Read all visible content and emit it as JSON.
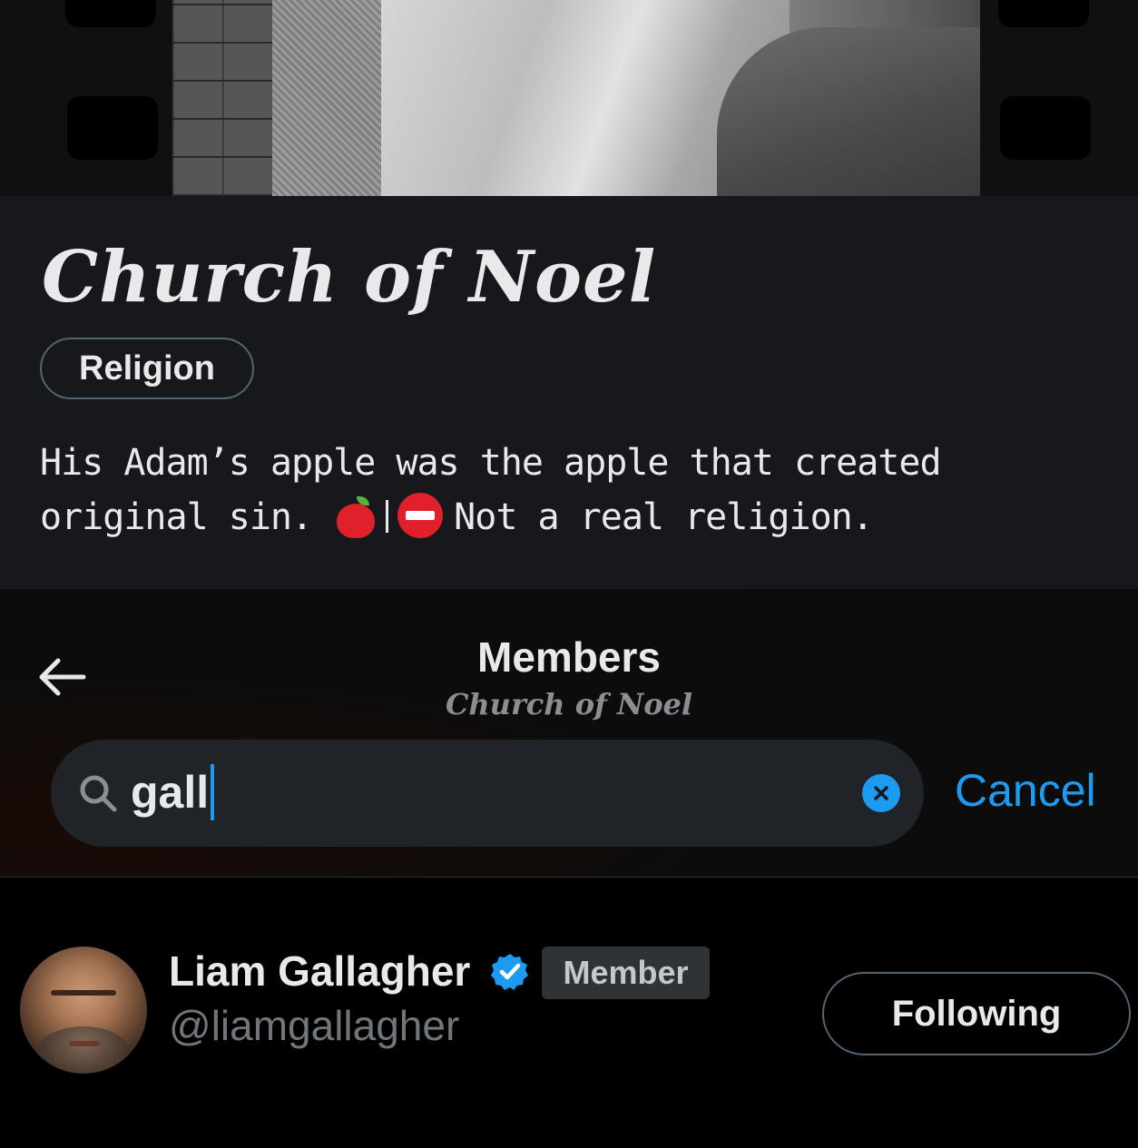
{
  "community": {
    "title": "Church of Noel",
    "category": "Religion",
    "description_part1": "His Adam’s apple was the apple that created original sin.",
    "description_part2": "Not a real religion."
  },
  "header": {
    "title": "Members",
    "subtitle": "Church of Noel"
  },
  "search": {
    "query": "gall",
    "cancel_label": "Cancel"
  },
  "results": [
    {
      "name": "Liam Gallagher",
      "handle": "@liamgallagher",
      "badge": "Member",
      "follow_label": "Following",
      "verified": true
    }
  ],
  "icons": {
    "back": "arrow-left-icon",
    "search": "search-icon",
    "clear": "close-icon",
    "verified": "verified-badge-icon",
    "apple": "red-apple-emoji",
    "no_entry": "no-entry-emoji"
  },
  "colors": {
    "accent": "#1d9bf0",
    "background": "#000000",
    "panel": "#16181c",
    "text": "#e7e9ea",
    "muted": "#71767b"
  }
}
